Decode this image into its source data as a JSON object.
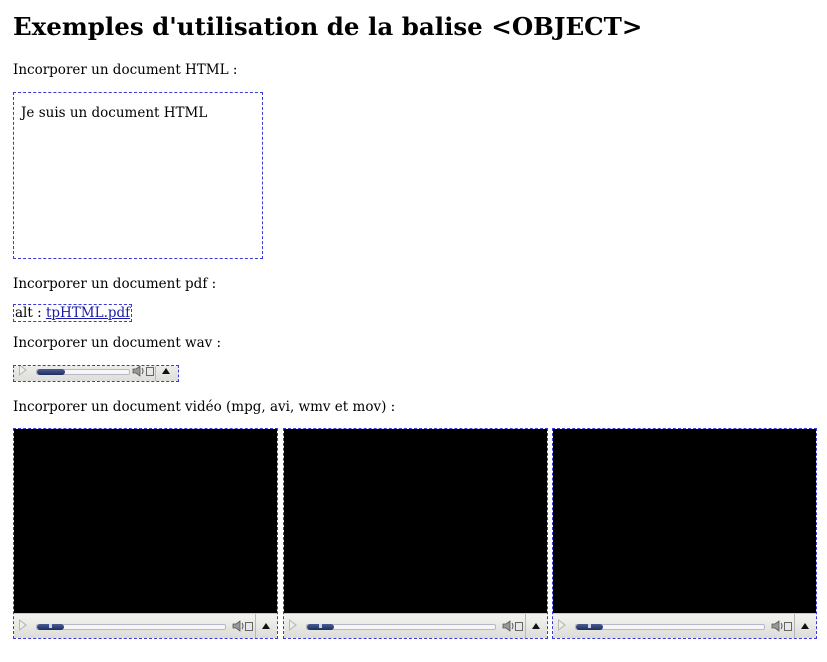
{
  "page": {
    "title": "Exemples d'utilisation de la balise <OBJECT>"
  },
  "sections": {
    "html_label": "Incorporer un document HTML :",
    "html_doc_text": "Je suis un document HTML",
    "pdf_label": "Incorporer un document pdf :",
    "pdf_alt_prefix": "alt : ",
    "pdf_link": "tpHTML.pdf",
    "wav_label": "Incorporer un document wav :",
    "video_label": "Incorporer un document vidéo (mpg, avi, wmv et mov) :"
  },
  "players": {
    "video_progress": [
      0.12,
      0.12,
      0.12
    ]
  },
  "icons": {
    "play": "play-icon",
    "volume": "speaker-icon",
    "mute": "mute-icon",
    "expand": "triangle-up-icon"
  },
  "colors": {
    "outline": "#3a3ad8",
    "link": "#1a1aa6",
    "video_bg": "#000000",
    "progress": "#1f2d5f"
  }
}
